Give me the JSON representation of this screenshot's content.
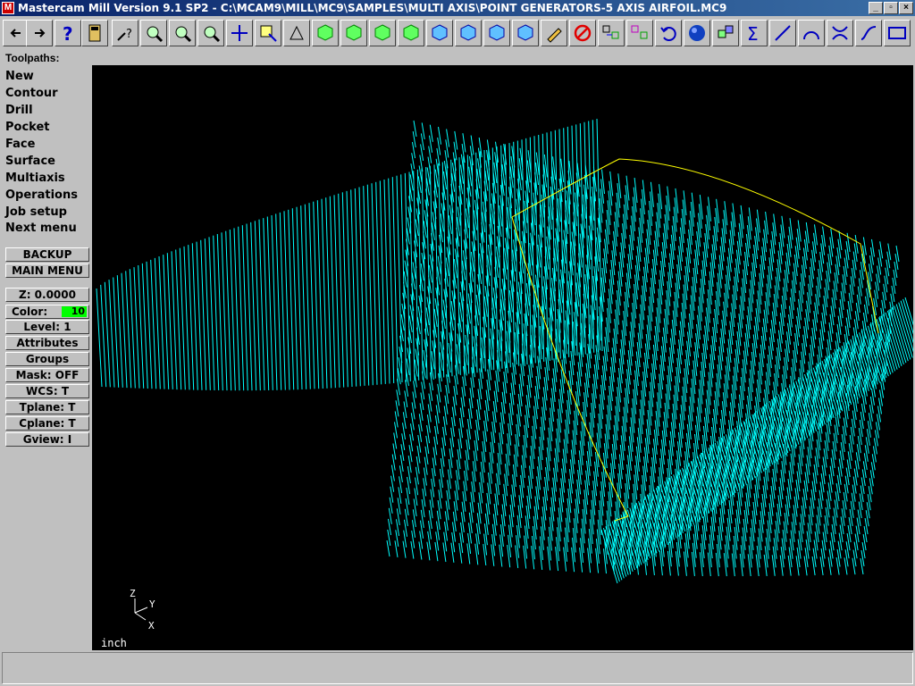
{
  "window": {
    "title": "Mastercam Mill Version 9.1 SP2 - C:\\MCAM9\\MILL\\MC9\\SAMPLES\\MULTI AXIS\\POINT GENERATORS-5 AXIS AIRFOIL.MC9",
    "app_icon": "mastercam-logo-icon"
  },
  "toolbar": {
    "buttons": [
      {
        "icon": "prev-arrow-icon"
      },
      {
        "icon": "next-arrow-icon"
      },
      {
        "icon": "help-icon"
      },
      {
        "icon": "calculator-icon"
      },
      {
        "icon": "analyze-icon"
      },
      {
        "icon": "zoom-window-icon"
      },
      {
        "icon": "zoom-icon"
      },
      {
        "icon": "zoom-out-icon"
      },
      {
        "icon": "pan-icon"
      },
      {
        "icon": "select-icon"
      },
      {
        "icon": "dynamic-rotate-icon"
      },
      {
        "icon": "iso-view-icon"
      },
      {
        "icon": "top-view-icon"
      },
      {
        "icon": "front-view-icon"
      },
      {
        "icon": "side-view-icon"
      },
      {
        "icon": "cplane-iso-icon"
      },
      {
        "icon": "cplane-top-icon"
      },
      {
        "icon": "cplane-front-icon"
      },
      {
        "icon": "cplane-side-icon"
      },
      {
        "icon": "pencil-icon"
      },
      {
        "icon": "delete-icon"
      },
      {
        "icon": "xform-translate-icon"
      },
      {
        "icon": "xform-mirror-icon"
      },
      {
        "icon": "undo-icon"
      },
      {
        "icon": "shade-sphere-icon"
      },
      {
        "icon": "group-icon"
      },
      {
        "icon": "sum-icon"
      },
      {
        "icon": "line-icon"
      },
      {
        "icon": "arc-icon"
      },
      {
        "icon": "trim-icon"
      },
      {
        "icon": "spline-icon"
      },
      {
        "icon": "rectangle-icon"
      }
    ]
  },
  "toolpaths_label": "Toolpaths:",
  "menu": {
    "items": [
      {
        "label": "New"
      },
      {
        "label": "Contour"
      },
      {
        "label": "Drill"
      },
      {
        "label": "Pocket"
      },
      {
        "label": "Face"
      },
      {
        "label": "Surface"
      },
      {
        "label": "Multiaxis"
      },
      {
        "label": "Operations"
      },
      {
        "label": "Job setup"
      },
      {
        "label": "Next menu"
      }
    ],
    "backup": "BACKUP",
    "main_menu": "MAIN MENU"
  },
  "status_panel": {
    "z": "Z:  0.0000",
    "color_label": "Color:",
    "color_value": "10",
    "color_swatch": "#00ff00",
    "level": "Level:  1",
    "attributes": "Attributes",
    "groups": "Groups",
    "mask": "Mask:  OFF",
    "wcs": "WCS:   T",
    "tplane": "Tplane:  T",
    "cplane": "Cplane:  T",
    "gview": "Gview:   I"
  },
  "viewport": {
    "units": "inch",
    "axis": {
      "z": "Z",
      "y": "Y",
      "x": "X"
    },
    "toolpath_color": "#00ffff",
    "geometry_color": "#ffff00"
  },
  "colors": {
    "titlebar_start": "#0a246a",
    "titlebar_end": "#3a6ea5",
    "face": "#c0c0c0"
  }
}
